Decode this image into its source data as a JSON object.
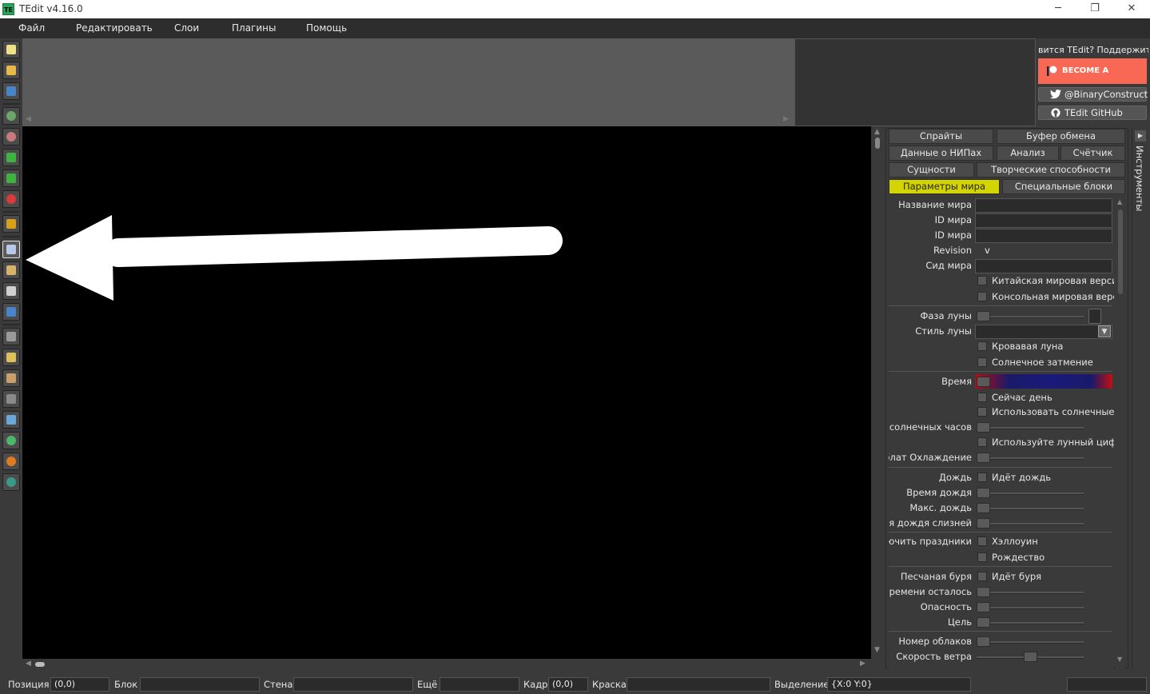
{
  "window": {
    "title": "TEdit v4.16.0",
    "icon_text": "TE",
    "minimize": "─",
    "maximize": "❐",
    "close": "✕"
  },
  "menu": [
    "Файл",
    "Редактировать",
    "Слои",
    "Плагины",
    "Помощь"
  ],
  "support": {
    "text": "вится TEdit? Поддержите",
    "patron_label": "BECOME A PATRON",
    "twitter_label": "@BinaryConstruct",
    "github_label": "TEdit GitHub"
  },
  "tabs": {
    "row1": [
      "Спрайты",
      "Буфер обмена"
    ],
    "row2": [
      "Данные о НИПах",
      "Анализ",
      "Счётчик"
    ],
    "row3": [
      "Сущности",
      "Творческие способности"
    ],
    "row4": [
      "Параметры мира",
      "Специальные блоки"
    ]
  },
  "vertical_tab": "Инструменты",
  "world": {
    "name_label": "Название мира",
    "id_label": "ID мира",
    "id2_label": "ID мира",
    "revision_label": "Revision",
    "revision_value": "v",
    "seed_label": "Сид мира",
    "chinese_label": "Китайская мировая версия",
    "console_label": "Консольная мировая верси",
    "moon_phase_label": "Фаза луны",
    "moon_style_label": "Стиль луны",
    "blood_moon_label": "Кровавая луна",
    "eclipse_label": "Солнечное затмение",
    "time_label": "Время",
    "day_label": "Сейчас день",
    "use_sundial_label": "Использовать солнечные ч",
    "sundial_hours_label": "солнечных часов",
    "use_moondial_label": "Используйте лунный цифер",
    "cooldown_label": "эблат Охлаждение",
    "rain_label": "Дождь",
    "raining_label": "Идёт дождь",
    "rain_time_label": "Время дождя",
    "max_rain_label": "Макс. дождь",
    "slime_rain_label": "мя дождя слизней",
    "holidays_label": "лючить праздники",
    "halloween_label": "Хэллоуин",
    "christmas_label": "Рождество",
    "sandstorm_label": "Песчаная буря",
    "storming_label": "Идёт буря",
    "time_left_label": "Времени осталось",
    "severity_label": "Опасность",
    "target_label": "Цель",
    "clouds_label": "Номер облаков",
    "wind_label": "Скорость ветра",
    "wind_level": 0.5
  },
  "status": {
    "position_label": "Позиция",
    "position_value": "(0,0)",
    "tile_label": "Блок",
    "wall_label": "Стена",
    "extra_label": "Ещё",
    "frame_label": "Кадр",
    "frame_value": "(0,0)",
    "paint_label": "Краска",
    "selection_label": "Выделение",
    "selection_value": "{X:0 Y:0}"
  },
  "colors": {
    "accent_tab": "#d4d400",
    "patron": "#f96854",
    "canvas": "#000000"
  }
}
